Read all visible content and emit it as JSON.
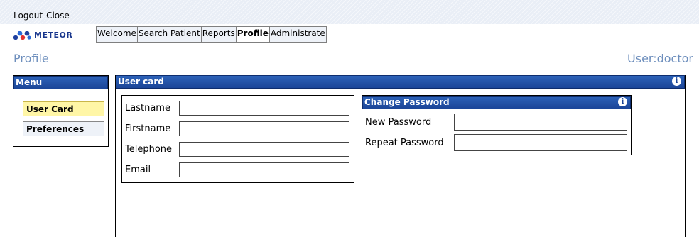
{
  "topbar": {
    "logout": "Logout",
    "close": "Close"
  },
  "logo": {
    "text": "METEOR"
  },
  "tabs": [
    {
      "label": "Welcome",
      "active": false
    },
    {
      "label": "Search Patient",
      "active": false
    },
    {
      "label": "Reports",
      "active": false
    },
    {
      "label": "Profile",
      "active": true
    },
    {
      "label": "Administrate",
      "active": false
    }
  ],
  "page": {
    "title": "Profile",
    "user": "User:doctor"
  },
  "menu": {
    "title": "Menu",
    "items": [
      {
        "label": "User Card",
        "active": true
      },
      {
        "label": "Preferences",
        "active": false
      }
    ]
  },
  "usercard": {
    "title": "User card",
    "fields": [
      {
        "label": "Lastname",
        "value": ""
      },
      {
        "label": "Firstname",
        "value": ""
      },
      {
        "label": "Telephone",
        "value": ""
      },
      {
        "label": "Email",
        "value": ""
      }
    ]
  },
  "password": {
    "title": "Change Password",
    "fields": [
      {
        "label": "New Password",
        "value": ""
      },
      {
        "label": "Repeat Password",
        "value": ""
      }
    ]
  },
  "colors": {
    "header_blue": "#1b4598",
    "title_blue": "#6e8fbd",
    "active_menu": "#fff6a6"
  },
  "icons": {
    "info": "info-icon"
  }
}
